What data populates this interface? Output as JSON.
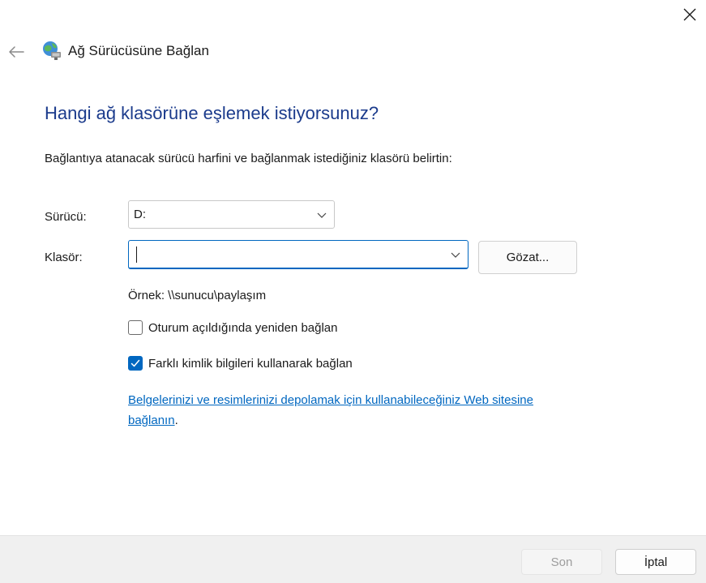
{
  "window": {
    "title": "Ağ Sürücüsüne Bağlan",
    "accent_color": "#0067c0",
    "heading_color": "#1b3b8c"
  },
  "icons": {
    "close": "close-icon",
    "back": "back-arrow-icon",
    "app": "network-drive-icon",
    "chevron": "chevron-down-icon",
    "checkmark": "checkmark-icon"
  },
  "main": {
    "heading": "Hangi ağ klasörüne eşlemek istiyorsunuz?",
    "instruction": "Bağlantıya atanacak sürücü harfini ve bağlanmak istediğiniz klasörü belirtin:",
    "drive": {
      "label": "Sürücü:",
      "value": "D:"
    },
    "folder": {
      "label": "Klasör:",
      "value": ""
    },
    "browse_label": "Gözat...",
    "example": "Örnek: \\\\sunucu\\paylaşım",
    "reconnect": {
      "label": "Oturum açıldığında yeniden bağlan",
      "checked": false
    },
    "different_credentials": {
      "label": "Farklı kimlik bilgileri kullanarak bağlan",
      "checked": true
    },
    "link": {
      "text": "Belgelerinizi ve resimlerinizi depolamak için kullanabileceğiniz Web sitesine bağlanın",
      "suffix": "."
    }
  },
  "footer": {
    "finish_label": "Son",
    "cancel_label": "İptal"
  }
}
